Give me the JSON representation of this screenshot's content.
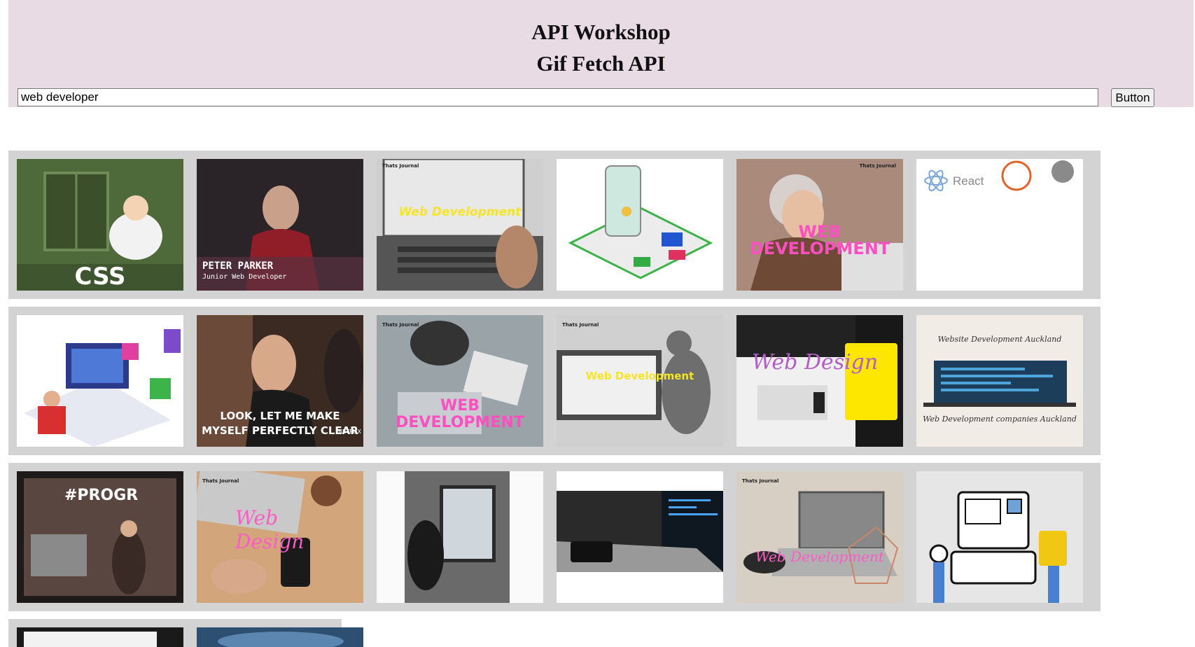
{
  "header": {
    "title": "API Workshop",
    "subtitle": "Gif Fetch API"
  },
  "search": {
    "value": "web developer",
    "button_label": "Button"
  },
  "gifs": [
    {
      "caption": "CSS"
    },
    {
      "caption": "PETER PARKER",
      "caption2": "Junior Web Developer"
    },
    {
      "caption": "Web Development",
      "watermark": "Thats Journal"
    },
    {
      "caption": ""
    },
    {
      "caption": "WEB DEVELOPMENT",
      "watermark": "Thats Journal"
    },
    {
      "caption": "React"
    },
    {
      "caption": ""
    },
    {
      "caption": "LOOK, LET ME MAKE",
      "caption2": "MYSELF PERFECTLY CLEAR",
      "badge": "NETFLIX"
    },
    {
      "caption": "WEB DEVELOPMENT",
      "watermark": "Thats Journal"
    },
    {
      "caption": "Web Development",
      "watermark": "Thats Journal"
    },
    {
      "caption": "Web Design"
    },
    {
      "caption": "Website Development Auckland",
      "caption2": "Web Development companies Auckland"
    },
    {
      "caption": "#PROGR"
    },
    {
      "caption": "Web Design",
      "watermark": "Thats Journal"
    },
    {
      "caption": ""
    },
    {
      "caption": ""
    },
    {
      "caption": "Web Development",
      "watermark": "Thats Journal"
    },
    {
      "caption": ""
    },
    {
      "caption": ""
    },
    {
      "caption": ""
    }
  ]
}
